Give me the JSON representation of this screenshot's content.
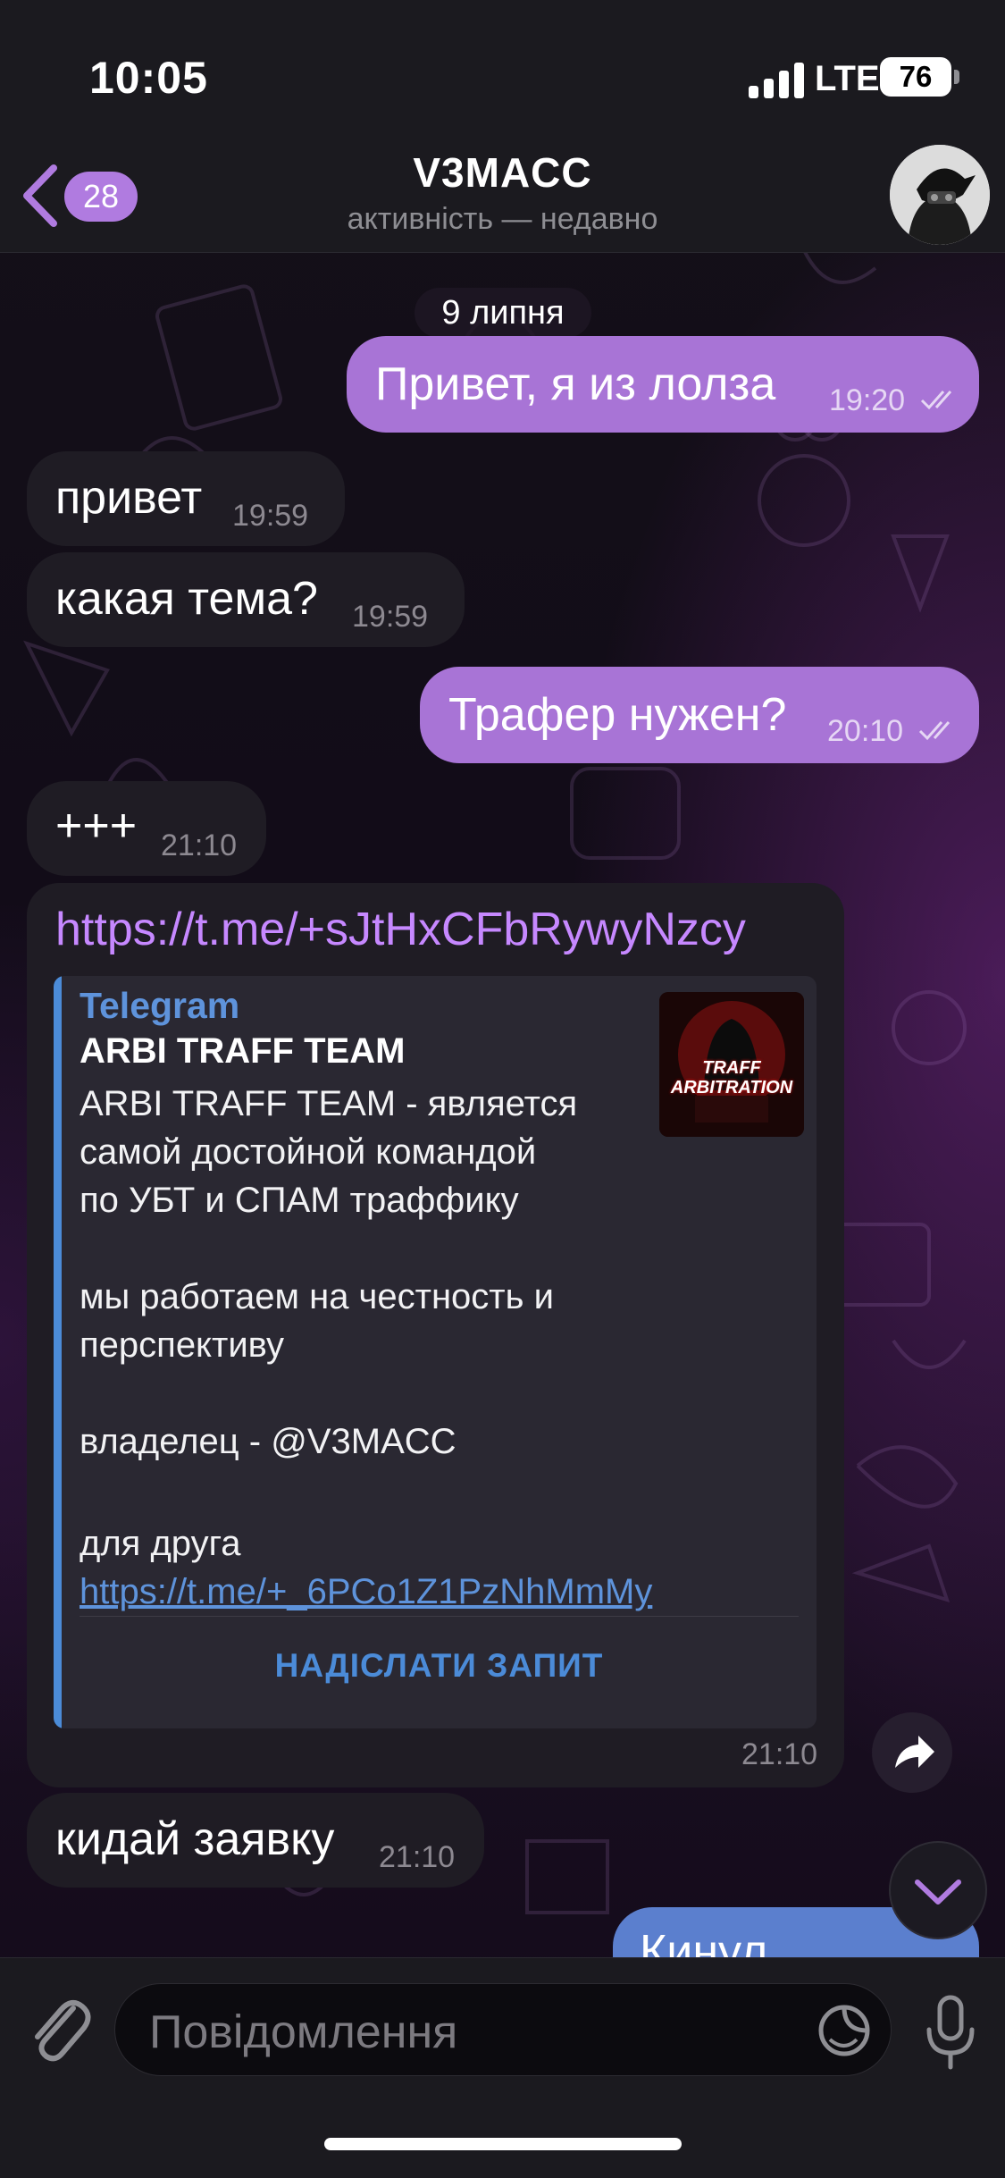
{
  "status_bar": {
    "time": "10:05",
    "network": "LTE",
    "battery": "76"
  },
  "header": {
    "back_count": "28",
    "title": "V3MACC",
    "subtitle": "активність — недавно",
    "icons": {
      "back": "chevron-left-icon",
      "avatar": "contact-avatar"
    }
  },
  "chat": {
    "date_label": "9 липня",
    "messages": [
      {
        "direction": "out",
        "text": "Привет, я из лолза",
        "time": "19:20",
        "status": "read"
      },
      {
        "direction": "in",
        "text": "привет",
        "time": "19:59"
      },
      {
        "direction": "in",
        "text": "какая тема?",
        "time": "19:59"
      },
      {
        "direction": "out",
        "text": "Трафер нужен?",
        "time": "20:10",
        "status": "read"
      },
      {
        "direction": "in",
        "text": "+++",
        "time": "21:10"
      },
      {
        "direction": "in",
        "text": "кидай заявку",
        "time": "21:10"
      },
      {
        "direction": "out",
        "text": "Кинул",
        "time": ""
      }
    ],
    "link_message": {
      "url": "https://t.me/+sJtHxCFbRywyNzcy",
      "time": "21:10",
      "preview": {
        "site": "Telegram",
        "title": "ARBI TRAFF TEAM",
        "description": "ARBI TRAFF TEAM - является\nсамой достойной командой\nпо УБТ и СПАМ траффику\n\nмы работаем на честность и\nперспективу\n\nвладелец - @V3MACC",
        "friend_prefix": "для друга ",
        "friend_link": "https://t.me/+_6PCo1Z1PzNhMmMy",
        "image_text": "TRAFF ARBITRATION",
        "button": "НАДІСЛАТИ ЗАПИТ"
      }
    }
  },
  "input": {
    "placeholder": "Повідомлення",
    "icons": {
      "attach": "paperclip-icon",
      "sticker": "sticker-icon",
      "mic": "microphone-icon"
    }
  },
  "colors": {
    "outgoing_bubble": "#a874d6",
    "incoming_bubble": "#1f1c24",
    "link": "#c688ff",
    "accent_blue": "#4b8bd8",
    "badge": "#b07be0"
  }
}
